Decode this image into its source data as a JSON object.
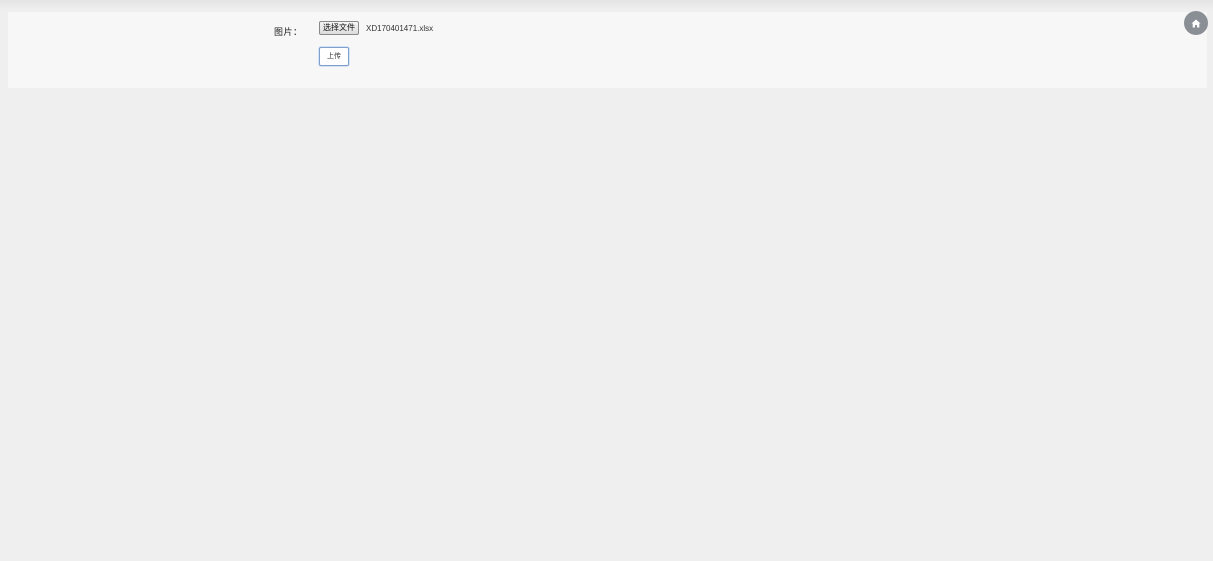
{
  "form": {
    "image_label": "图片：",
    "choose_file_label": "选择文件",
    "selected_file_name": "XD170401471.xlsx",
    "upload_label": "上传"
  },
  "floating": {
    "home_icon": "home-icon"
  },
  "colors": {
    "page_background": "#efefef",
    "panel_background": "#f7f7f7",
    "home_button": "#8a8f96",
    "upload_border": "#7fa0cc"
  }
}
